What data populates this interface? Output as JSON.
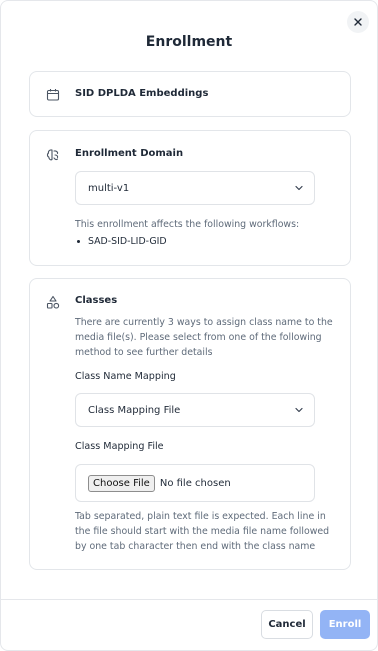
{
  "dialog": {
    "title": "Enrollment",
    "close_icon": "close-icon"
  },
  "model_card": {
    "icon": "calendar-icon",
    "title": "SID DPLDA Embeddings"
  },
  "domain_card": {
    "icon": "brain-icon",
    "title": "Enrollment Domain",
    "selected": "multi-v1",
    "description": "This enrollment affects the following workflows:",
    "workflows": [
      "SAD-SID-LID-GID"
    ]
  },
  "classes_card": {
    "icon": "shapes-icon",
    "title": "Classes",
    "description": "There are currently 3 ways to assign class name to the media file(s). Please select from one of the following method to see further details",
    "mapping_label": "Class Name Mapping",
    "mapping_selected": "Class Mapping File",
    "file_label": "Class Mapping File",
    "choose_file": "Choose File",
    "no_file": "No file chosen",
    "help": "Tab separated, plain text file is expected. Each line in the file should start with the media file name followed by one tab character then end with the class name"
  },
  "footer": {
    "cancel_label": "Cancel",
    "enroll_label": "Enroll"
  },
  "colors": {
    "enroll_disabled": "#93b4f5",
    "muted_text": "#5f6b7a"
  }
}
